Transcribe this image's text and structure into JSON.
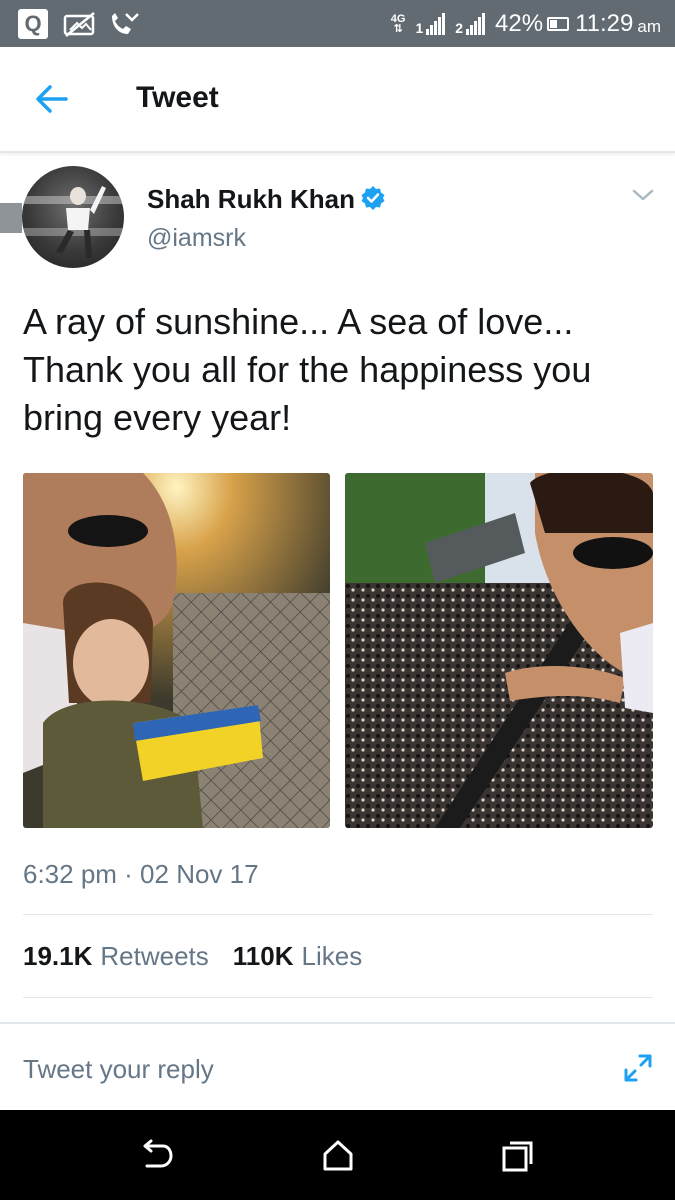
{
  "status_bar": {
    "network": "4G",
    "sim1": "1",
    "sim2": "2",
    "battery": "42%",
    "time": "11:29",
    "ampm": "am"
  },
  "header": {
    "title": "Tweet"
  },
  "tweet": {
    "author_name": "Shah Rukh Khan",
    "handle": "@iamsrk",
    "text": "A ray of sunshine... A sea of love... Thank you all for the happiness you bring every year!",
    "timestamp": "6:32 pm · 02 Nov 17",
    "retweets_count": "19.1K",
    "retweets_label": "Retweets",
    "likes_count": "110K",
    "likes_label": "Likes"
  },
  "reply": {
    "placeholder": "Tweet your reply"
  },
  "colors": {
    "accent": "#1da1f2",
    "text_primary": "#14171a",
    "text_secondary": "#657786",
    "status_bar_bg": "#626a72",
    "nav_bar_bg": "#000000"
  },
  "icons": {
    "back": "arrow-left-icon",
    "verified": "verified-badge-icon",
    "more": "chevron-down-icon",
    "expand": "expand-icon",
    "nav_back": "nav-back-icon",
    "nav_home": "nav-home-icon",
    "nav_recents": "nav-recents-icon"
  }
}
